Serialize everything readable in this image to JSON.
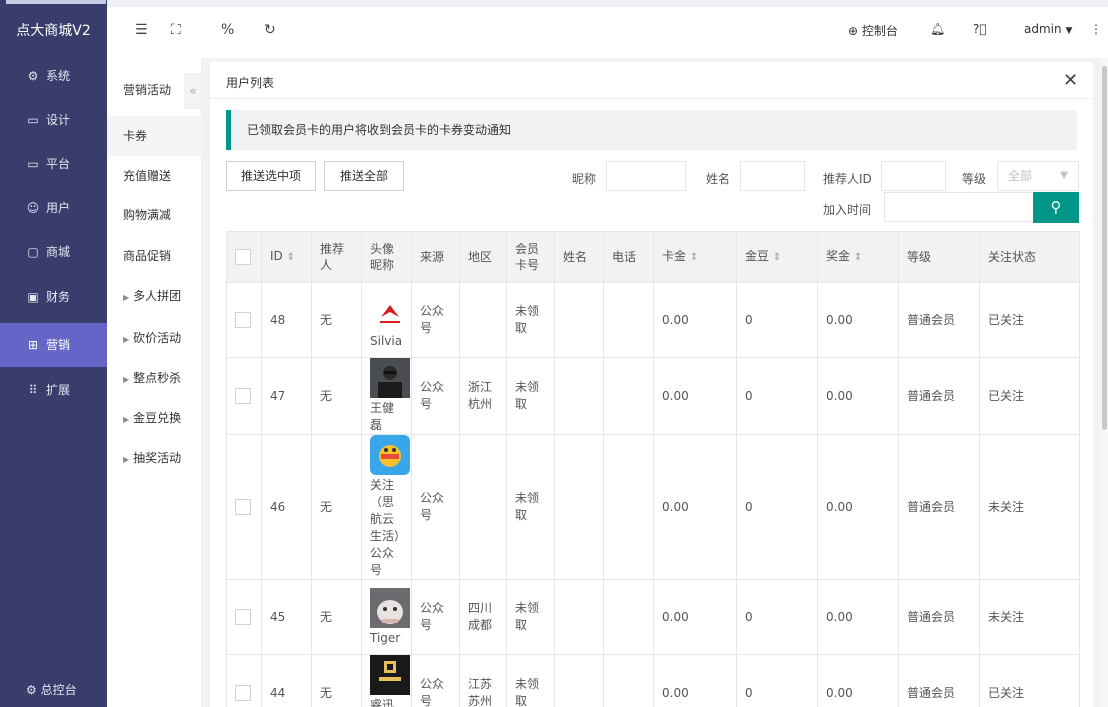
{
  "app": {
    "logo_text": "点大商城V2"
  },
  "nav": {
    "items": [
      {
        "label": "系统",
        "icon": "gear-icon"
      },
      {
        "label": "设计",
        "icon": "monitor-icon"
      },
      {
        "label": "平台",
        "icon": "monitor-icon"
      },
      {
        "label": "用户",
        "icon": "users-icon"
      },
      {
        "label": "商城",
        "icon": "shop-icon"
      },
      {
        "label": "财务",
        "icon": "finance-icon"
      },
      {
        "label": "营销",
        "icon": "gift-icon"
      },
      {
        "label": "扩展",
        "icon": "grid-icon"
      }
    ],
    "active_index": 6,
    "bottom_label": "总控台"
  },
  "topbar": {
    "console_label": "控制台",
    "user_label": "admin"
  },
  "subnav": {
    "header": "营销活动",
    "items": [
      {
        "label": "卡券",
        "has_arrow": false
      },
      {
        "label": "充值赠送",
        "has_arrow": false
      },
      {
        "label": "购物满减",
        "has_arrow": false
      },
      {
        "label": "商品促销",
        "has_arrow": false
      },
      {
        "label": "多人拼团",
        "has_arrow": true
      },
      {
        "label": "砍价活动",
        "has_arrow": true
      },
      {
        "label": "整点秒杀",
        "has_arrow": true
      },
      {
        "label": "金豆兑换",
        "has_arrow": true
      },
      {
        "label": "抽奖活动",
        "has_arrow": true
      }
    ],
    "active_index": 0
  },
  "panel": {
    "title": "用户列表",
    "notice": "已领取会员卡的用户将收到会员卡的卡券变动通知"
  },
  "filters": {
    "push_selected": "推送选中项",
    "push_all": "推送全部",
    "nickname_label": "昵称",
    "name_label": "姓名",
    "referrer_label": "推荐人ID",
    "level_label": "等级",
    "level_value": "全部",
    "join_time_label": "加入时间"
  },
  "table": {
    "headers": {
      "id": "ID",
      "referrer": "推荐人",
      "avatar": "头像昵称",
      "source": "来源",
      "region": "地区",
      "card_no": "会员卡号",
      "name": "姓名",
      "phone": "电话",
      "card_money": "卡金",
      "bean": "金豆",
      "bonus": "奖金",
      "level": "等级",
      "follow": "关注状态"
    },
    "rows": [
      {
        "id": "48",
        "referrer": "无",
        "nickname": "Silvia",
        "avatar_style": "logo",
        "source": "公众号",
        "region": "",
        "card_no": "未领取",
        "name": "",
        "phone": "",
        "card_money": "0.00",
        "bean": "0",
        "bonus": "0.00",
        "level": "普通会员",
        "follow": "已关注",
        "followed": true,
        "height": 75
      },
      {
        "id": "47",
        "referrer": "无",
        "nickname": "王健磊",
        "avatar_style": "dark",
        "source": "公众号",
        "region": "浙江杭州",
        "card_no": "未领取",
        "name": "",
        "phone": "",
        "card_money": "0.00",
        "bean": "0",
        "bonus": "0.00",
        "level": "普通会员",
        "follow": "已关注",
        "followed": true,
        "height": 75
      },
      {
        "id": "46",
        "referrer": "无",
        "nickname": "关注（思航云生活）公众号",
        "avatar_style": "blue",
        "source": "公众号",
        "region": "",
        "card_no": "未领取",
        "name": "",
        "phone": "",
        "card_money": "0.00",
        "bean": "0",
        "bonus": "0.00",
        "level": "普通会员",
        "follow": "未关注",
        "followed": false,
        "height": 137
      },
      {
        "id": "45",
        "referrer": "无",
        "nickname": "Tiger",
        "avatar_style": "cat",
        "source": "公众号",
        "region": "四川成都",
        "card_no": "未领取",
        "name": "",
        "phone": "",
        "card_money": "0.00",
        "bean": "0",
        "bonus": "0.00",
        "level": "普通会员",
        "follow": "未关注",
        "followed": false,
        "height": 75
      },
      {
        "id": "44",
        "referrer": "无",
        "nickname": "睿迅互",
        "avatar_style": "black",
        "source": "公众号",
        "region": "江苏苏州",
        "card_no": "未领取",
        "name": "",
        "phone": "",
        "card_money": "0.00",
        "bean": "0",
        "bonus": "0.00",
        "level": "普通会员",
        "follow": "已关注",
        "followed": true,
        "height": 75
      }
    ]
  },
  "colors": {
    "nav_bg": "#393d6b",
    "nav_active": "#6565c8",
    "accent": "#009688",
    "followed": "#009900",
    "not_followed": "#e60000"
  }
}
